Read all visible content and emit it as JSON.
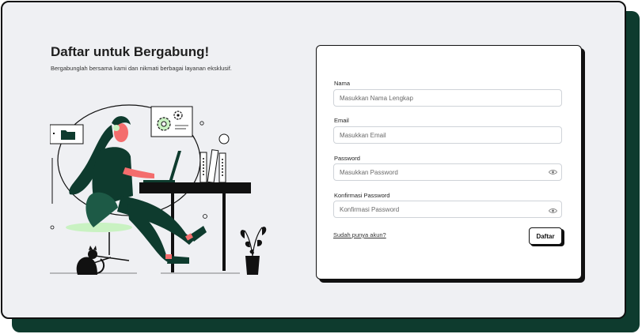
{
  "header": {
    "title": "Daftar untuk Bergabung!",
    "subtitle": "Bergabunglah bersama kami dan nikmati berbagai layanan eksklusif."
  },
  "form": {
    "name": {
      "label": "Nama",
      "placeholder": "Masukkan Nama Lengkap",
      "value": ""
    },
    "email": {
      "label": "Email",
      "placeholder": "Masukkan Email",
      "value": ""
    },
    "password": {
      "label": "Password",
      "placeholder": "Masukkan Password",
      "value": "",
      "icon": "eye-icon"
    },
    "confirm_password": {
      "label": "Konfirmasi Password",
      "placeholder": "Konfirmasi Password",
      "value": "",
      "icon": "eye-icon"
    },
    "login_link": "Sudah punya akun?",
    "submit_label": "Daftar"
  },
  "colors": {
    "background": "#eff0f3",
    "accent_dark_green": "#0e3b2e",
    "illustration_skin": "#f46d6d",
    "illustration_light_green": "#c9f2c2",
    "border_black": "#111111"
  }
}
